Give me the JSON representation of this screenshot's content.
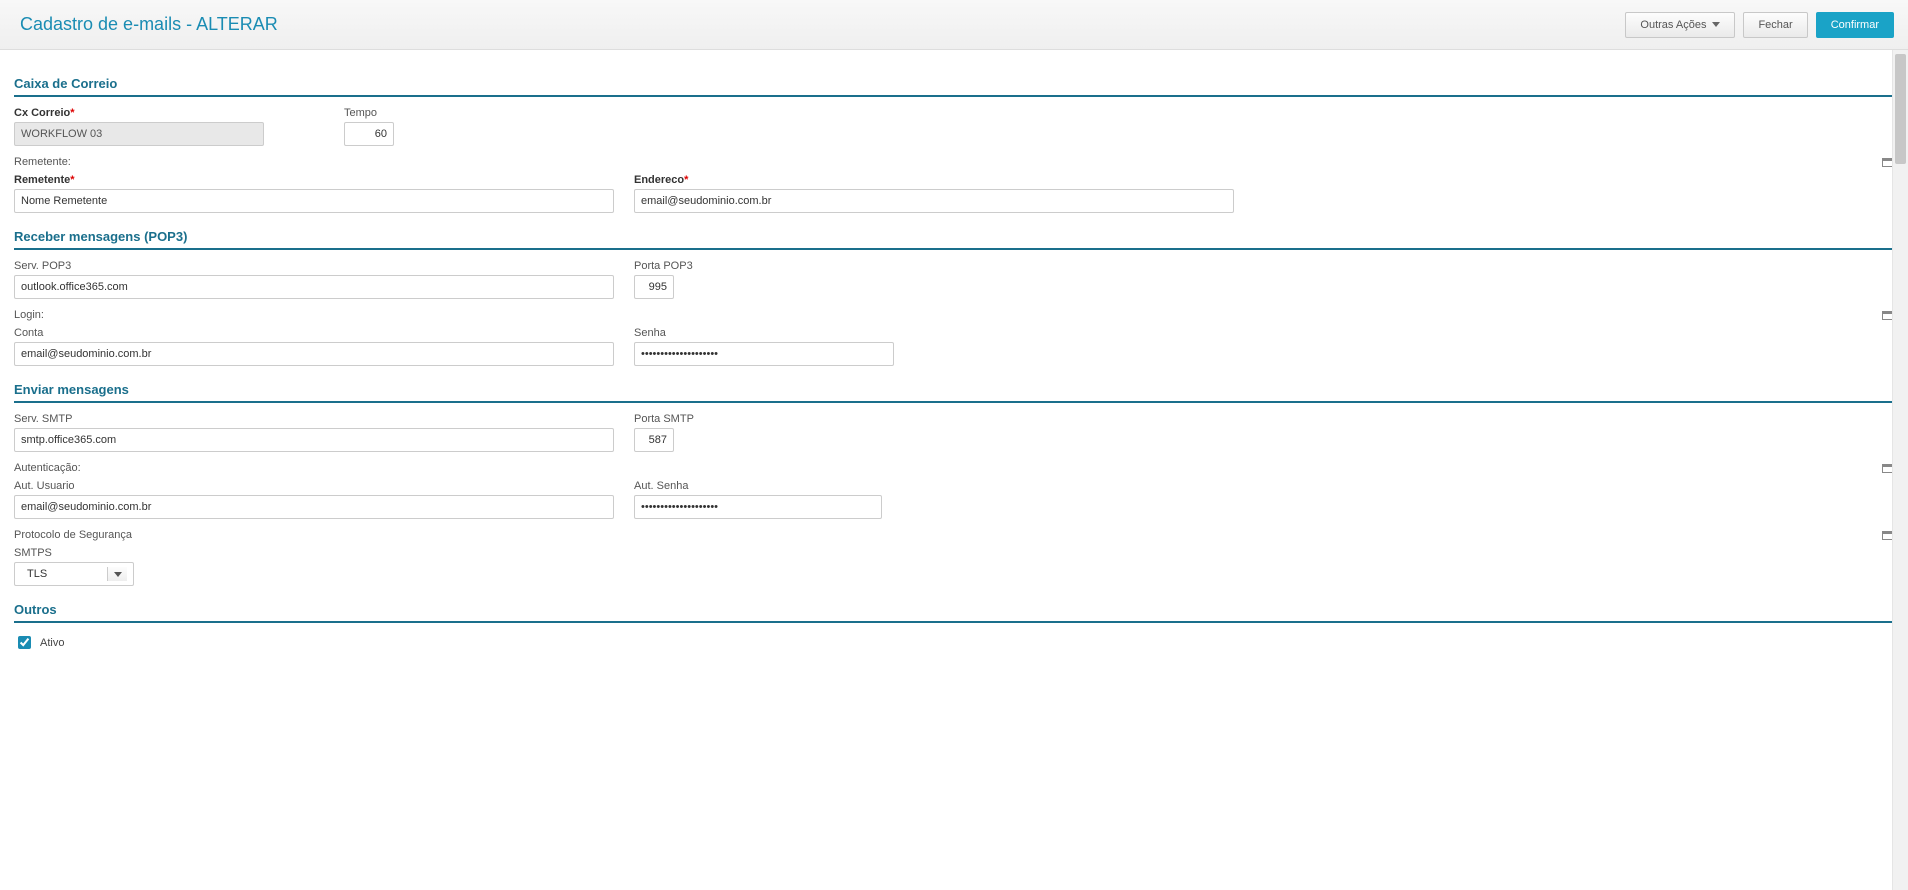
{
  "header": {
    "title": "Cadastro de e-mails - ALTERAR",
    "actions": {
      "other": "Outras Ações",
      "close": "Fechar",
      "confirm": "Confirmar"
    }
  },
  "section_mailbox": {
    "title": "Caixa de Correio",
    "cx_correio_label": "Cx Correio",
    "cx_correio_value": "WORKFLOW 03",
    "tempo_label": "Tempo",
    "tempo_value": "60"
  },
  "remetente_group": {
    "subheader": "Remetente:",
    "remetente_label": "Remetente",
    "remetente_value": "Nome Remetente",
    "endereco_label": "Endereco",
    "endereco_value": "email@seudominio.com.br"
  },
  "section_pop3": {
    "title": "Receber mensagens (POP3)",
    "serv_label": "Serv. POP3",
    "serv_value": "outlook.office365.com",
    "porta_label": "Porta POP3",
    "porta_value": "995"
  },
  "login_group": {
    "subheader": "Login:",
    "conta_label": "Conta",
    "conta_value": "email@seudominio.com.br",
    "senha_label": "Senha",
    "senha_value": "********************"
  },
  "section_send": {
    "title": "Enviar mensagens",
    "serv_label": "Serv. SMTP",
    "serv_value": "smtp.office365.com",
    "porta_label": "Porta SMTP",
    "porta_value": "587"
  },
  "auth_group": {
    "subheader": "Autenticação:",
    "user_label": "Aut. Usuario",
    "user_value": "email@seudominio.com.br",
    "senha_label": "Aut. Senha",
    "senha_value": "********************"
  },
  "proto_group": {
    "subheader": "Protocolo de Segurança",
    "smtps_label": "SMTPS",
    "smtps_value": "TLS"
  },
  "section_others": {
    "title": "Outros",
    "ativo_label": "Ativo"
  }
}
